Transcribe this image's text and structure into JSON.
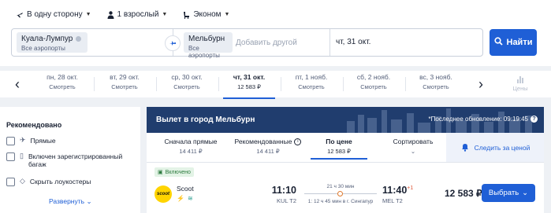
{
  "search_options": {
    "trip_type": "В одну сторону",
    "passengers": "1 взрослый",
    "cabin_class": "Эконом"
  },
  "search": {
    "from_city": "Куала-Лумпур",
    "from_sub": "Все аэропорты",
    "to_city": "Мельбурн",
    "to_sub": "Все аэропорты",
    "add_other": "Добавить другой",
    "date": "чт, 31 окт.",
    "find_label": "Найти"
  },
  "dates": [
    {
      "day": "пн, 28 окт.",
      "price": "Смотреть"
    },
    {
      "day": "вт, 29 окт.",
      "price": "Смотреть"
    },
    {
      "day": "ср, 30 окт.",
      "price": "Смотреть"
    },
    {
      "day": "чт, 31 окт.",
      "price": "12 583 ₽"
    },
    {
      "day": "пт, 1 нояб.",
      "price": "Смотреть"
    },
    {
      "day": "сб, 2 нояб.",
      "price": "Смотреть"
    },
    {
      "day": "вс, 3 нояб.",
      "price": "Смотреть"
    }
  ],
  "prices_label": "Цены",
  "filters": {
    "title": "Рекомендовано",
    "items": [
      "Прямые",
      "Включен зарегистрированный багаж",
      "Скрыть лоукостеры"
    ],
    "more": "Развернуть"
  },
  "results": {
    "header_title": "Вылет в город Мельбурн",
    "last_update": "*Последнее обновление: 09:19:45",
    "tabs": [
      {
        "label": "Сначала прямые",
        "value": "14 411 ₽"
      },
      {
        "label": "Рекомендованные",
        "value": "14 411 ₽"
      },
      {
        "label": "По цене",
        "value": "12 583 ₽"
      },
      {
        "label": "Сортировать",
        "value": ""
      }
    ],
    "watch_label": "Следить за ценой"
  },
  "flight": {
    "badge": "Включено",
    "airline": "Scoot",
    "logo_text": "scoot",
    "dep_time": "11:10",
    "dep_airport": "KUL T2",
    "duration": "21 ч 30 мин",
    "stop_info": "1: 12 ч 45 мин в г. Сингапур",
    "arr_time": "11:40",
    "arr_plus": "+1",
    "arr_airport": "MEL T2",
    "price": "12 583 ₽",
    "select_label": "Выбрать"
  },
  "colors": {
    "accent": "#1f5fd6",
    "header_bg": "#203d6e",
    "stop_marker": "#e07a2e",
    "next_day": "#e05a3a"
  }
}
